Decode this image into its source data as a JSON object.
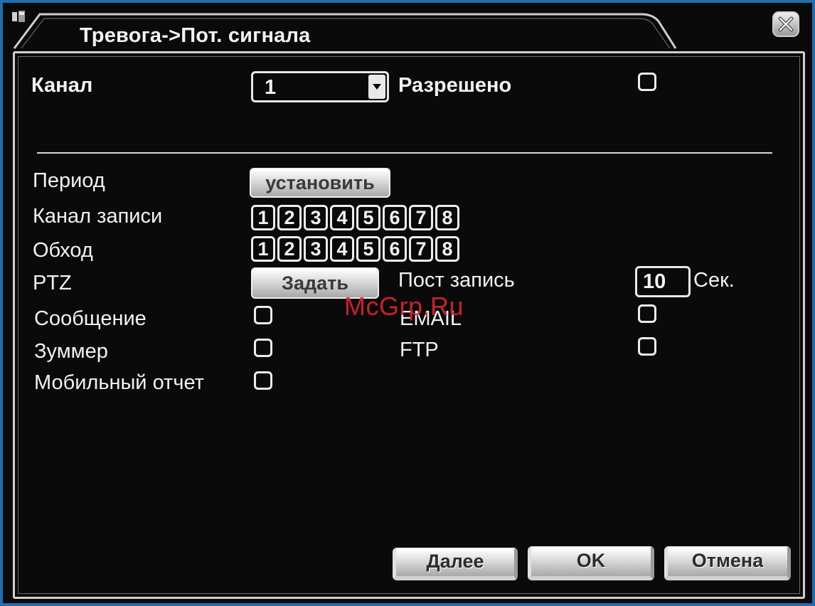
{
  "window": {
    "title": "Тревога->Пот. сигнала",
    "close_icon": "close-icon"
  },
  "form": {
    "channel_label": "Канал",
    "channel_value": "1",
    "enabled_label": "Разрешено",
    "enabled_checked": false,
    "period_label": "Период",
    "period_button": "установить",
    "record_channel_label": "Канал записи",
    "record_channels": [
      "1",
      "2",
      "3",
      "4",
      "5",
      "6",
      "7",
      "8"
    ],
    "tour_label": "Обход",
    "tour_channels": [
      "1",
      "2",
      "3",
      "4",
      "5",
      "6",
      "7",
      "8"
    ],
    "ptz_label": "PTZ",
    "ptz_button": "Задать",
    "post_record_label": "Пост запись",
    "post_record_value": "10",
    "post_record_unit": "Сек.",
    "message_label": "Сообщение",
    "message_checked": false,
    "email_label": "EMAIL",
    "email_checked": false,
    "buzzer_label": "Зуммер",
    "buzzer_checked": false,
    "ftp_label": "FTP",
    "ftp_checked": false,
    "mobile_report_label": "Мобильный отчет",
    "mobile_report_checked": false
  },
  "buttons": {
    "next": "Далее",
    "ok": "OK",
    "cancel": "Отмена"
  },
  "watermark": "McGrp.Ru",
  "colors": {
    "background": "#0a0a0a",
    "outer_border": "#1f6fb0",
    "text": "#f2f2f2",
    "watermark": "#d8252b"
  }
}
